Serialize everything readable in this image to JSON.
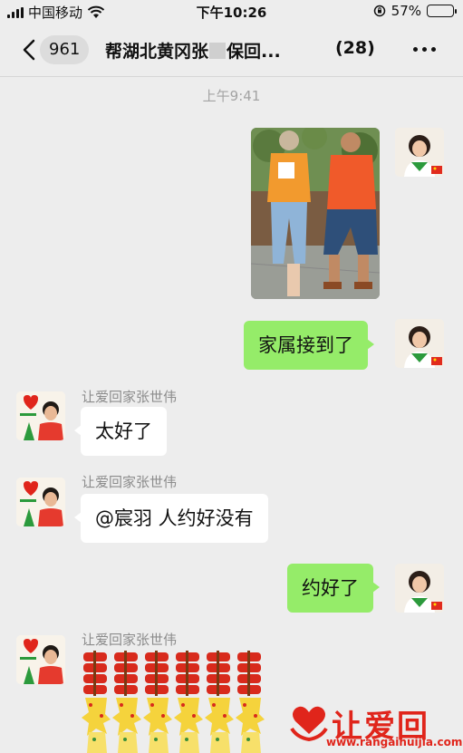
{
  "status_bar": {
    "carrier": "中国移动",
    "time": "下午10:26",
    "battery": "57%",
    "battery_level": 0.57
  },
  "nav": {
    "back_count": "961",
    "title_prefix": "帮湖北黄冈张",
    "title_suffix": "保回...",
    "member_count": "(28)"
  },
  "timestamp": "上午9:41",
  "messages": {
    "m2": {
      "text": "家属接到了"
    },
    "m3": {
      "sender": "让爱回家张世伟",
      "text": "太好了"
    },
    "m4": {
      "sender": "让爱回家张世伟",
      "text": "@宸羽 人约好没有"
    },
    "m5": {
      "text": "约好了"
    },
    "m6": {
      "sender": "让爱回家张世伟"
    }
  },
  "watermark": {
    "brand": "让爱回家",
    "url": "www.rangaihuijia.com"
  },
  "colors": {
    "me_bubble": "#95ec69",
    "other_bubble": "#ffffff",
    "chat_bg": "#ededed",
    "brand_red": "#e0251b"
  }
}
